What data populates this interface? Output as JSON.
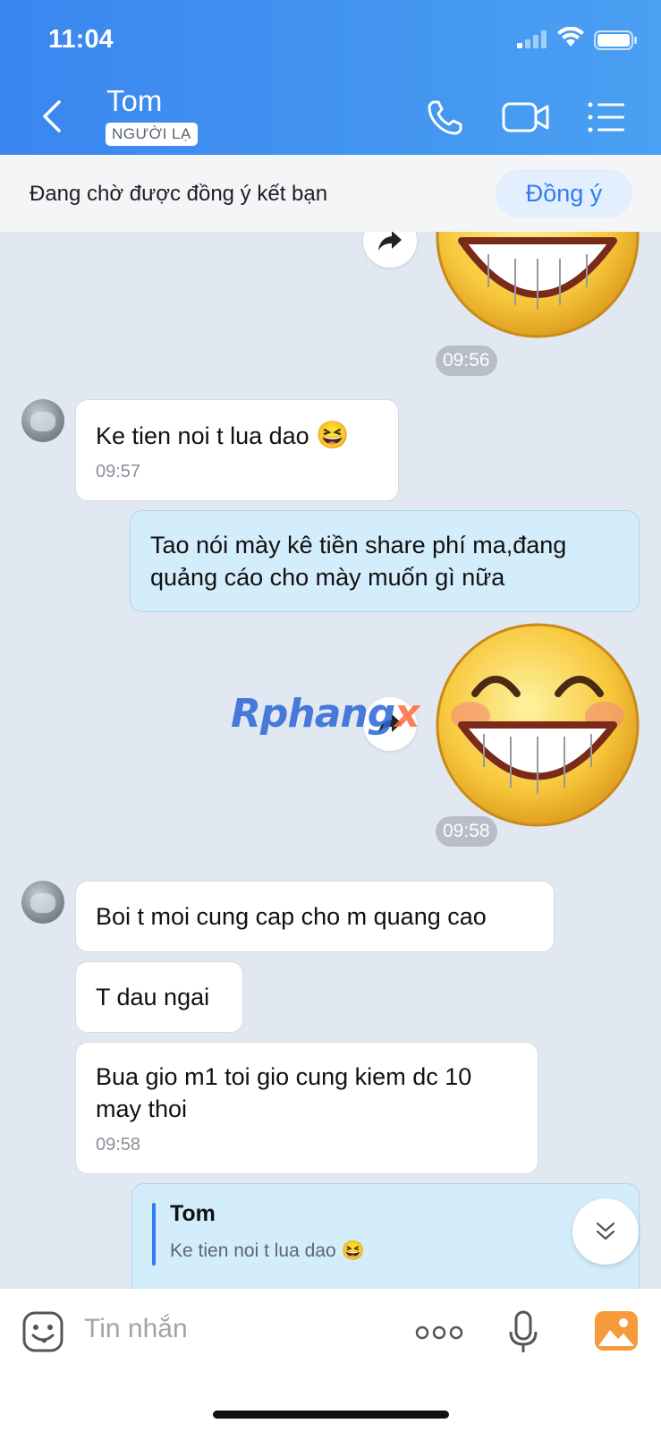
{
  "status_bar": {
    "time": "11:04"
  },
  "header": {
    "contact_name": "Tom",
    "badge": "NGƯỜI LẠ",
    "icons": [
      "back-arrow-icon",
      "phone-icon",
      "video-call-icon",
      "menu-list-icon"
    ]
  },
  "friend_request": {
    "text": "Đang chờ được đồng ý kết bạn",
    "accept_label": "Đồng ý"
  },
  "messages": {
    "time_1": "09:56",
    "m1": {
      "text": "Ke tien noi t lua dao",
      "emoji": "😆",
      "time": "09:57"
    },
    "m2": {
      "text": "Tao nói mày kê tiền share phí ma,đang quảng cáo cho mày muốn gì nữa"
    },
    "time_2": "09:58",
    "m3": {
      "text": "Boi t moi cung cap cho m quang cao"
    },
    "m4": {
      "text": "T dau ngai"
    },
    "m5": {
      "text": "Bua gio m1 toi gio cung kiem dc 10 may thoi",
      "time": "09:58"
    },
    "reply": {
      "name": "Tom",
      "quote": "Ke tien noi t lua dao",
      "emoji": "😆"
    }
  },
  "watermark": {
    "main": "Rphang",
    "tail": "x"
  },
  "input": {
    "placeholder": "Tin nhắn"
  },
  "colors": {
    "header": "#3a86f0",
    "accent": "#2f7df0",
    "outgoing": "#d4edfb",
    "chat_bg": "#e2e8f1"
  }
}
